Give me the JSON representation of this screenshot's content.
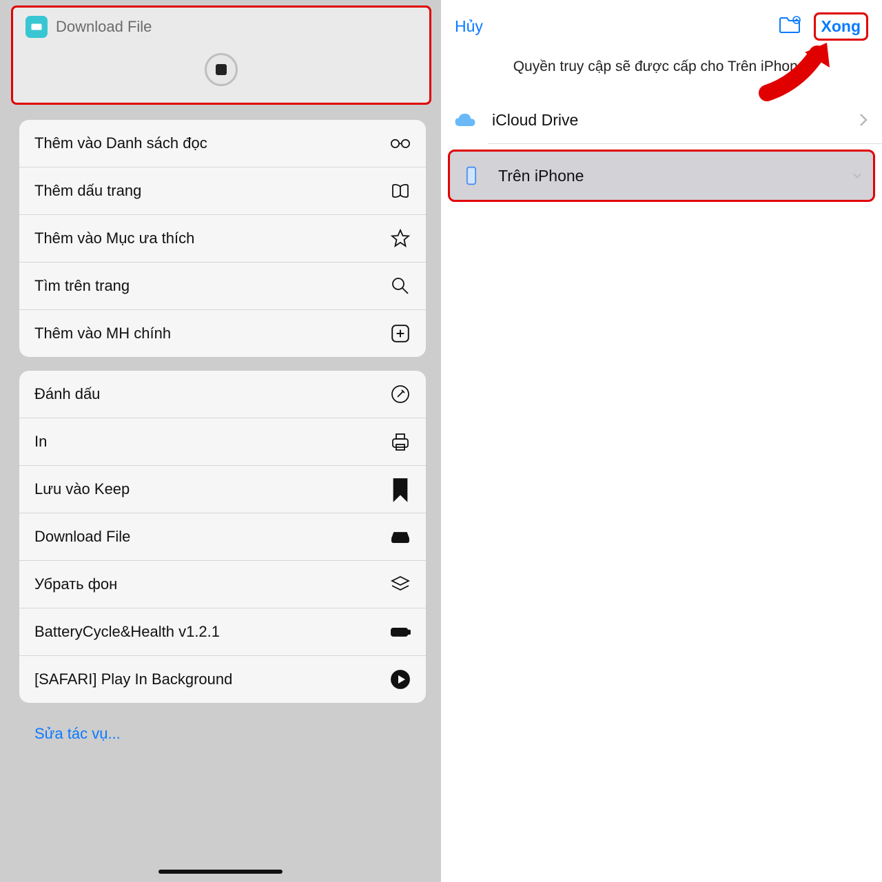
{
  "left": {
    "app_title": "Download File",
    "group1": [
      {
        "label": "Thêm vào Danh sách đọc",
        "icon": "glasses-icon"
      },
      {
        "label": "Thêm dấu trang",
        "icon": "book-icon"
      },
      {
        "label": "Thêm vào Mục ưa thích",
        "icon": "star-icon"
      },
      {
        "label": "Tìm trên trang",
        "icon": "search-icon"
      },
      {
        "label": "Thêm vào MH chính",
        "icon": "plus-square-icon"
      }
    ],
    "group2": [
      {
        "label": "Đánh dấu",
        "icon": "markup-icon"
      },
      {
        "label": "In",
        "icon": "print-icon"
      },
      {
        "label": "Lưu vào Keep",
        "icon": "bookmark-icon"
      },
      {
        "label": "Download File",
        "icon": "drive-icon"
      },
      {
        "label": "Убрать фон",
        "icon": "layers-icon"
      },
      {
        "label": "BatteryCycle&Health v1.2.1",
        "icon": "battery-icon"
      },
      {
        "label": "[SAFARI] Play In Background",
        "icon": "play-circle-icon"
      }
    ],
    "edit_actions": "Sửa tác vụ..."
  },
  "right": {
    "cancel": "Hủy",
    "done": "Xong",
    "info": "Quyền truy cập sẽ được cấp cho Trên iPhone.",
    "locations": [
      {
        "label": "iCloud Drive",
        "icon": "cloud-icon"
      },
      {
        "label": "Trên iPhone",
        "icon": "iphone-icon"
      }
    ]
  }
}
